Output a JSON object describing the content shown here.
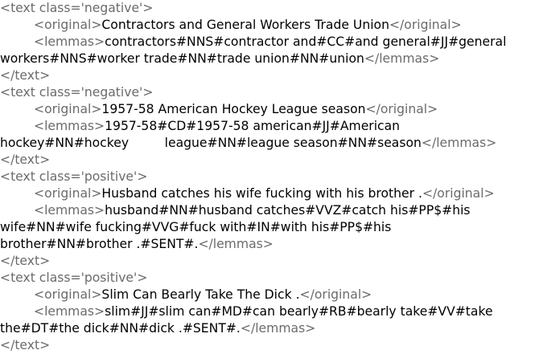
{
  "colors": {
    "tag": "#6b6b6b",
    "text": "#000000",
    "background": "#ffffff"
  },
  "entries": [
    {
      "open_tag": "<text class='negative'>",
      "original": "Contractors and General Workers Trade Union",
      "lemmas_line1": "contractors#NNS#contractor and#CC#and general#JJ#general",
      "lemmas_line2": "workers#NNS#worker trade#NN#trade union#NN#union",
      "close_tag": "</text>"
    },
    {
      "open_tag": "<text class='negative'>",
      "original": "1957-58 American Hockey League season",
      "lemmas_line1": "1957-58#CD#1957-58 american#JJ#American",
      "lemmas_line2": "hockey#NN#hockey         league#NN#league season#NN#season",
      "close_tag": "</text>"
    },
    {
      "open_tag": "<text class='positive'>",
      "original": "Husband catches his wife fucking with his brother .",
      "lemmas_line1": "husband#NN#husband catches#VVZ#catch his#PP$#his",
      "lemmas_line2": "wife#NN#wife fucking#VVG#fuck with#IN#with his#PP$#his",
      "lemmas_line3": "brother#NN#brother .#SENT#.",
      "close_tag": "</text>"
    },
    {
      "open_tag": "<text class='positive'>",
      "original": "Slim Can Bearly Take The Dick .",
      "lemmas_line1": "slim#JJ#slim can#MD#can bearly#RB#bearly take#VV#take",
      "lemmas_line2": "the#DT#the dick#NN#dick .#SENT#.",
      "close_tag": "</text>"
    }
  ],
  "tags": {
    "original_open": "<original>",
    "original_close": "</original>",
    "lemmas_open": "<lemmas>",
    "lemmas_close": "</lemmas>"
  }
}
